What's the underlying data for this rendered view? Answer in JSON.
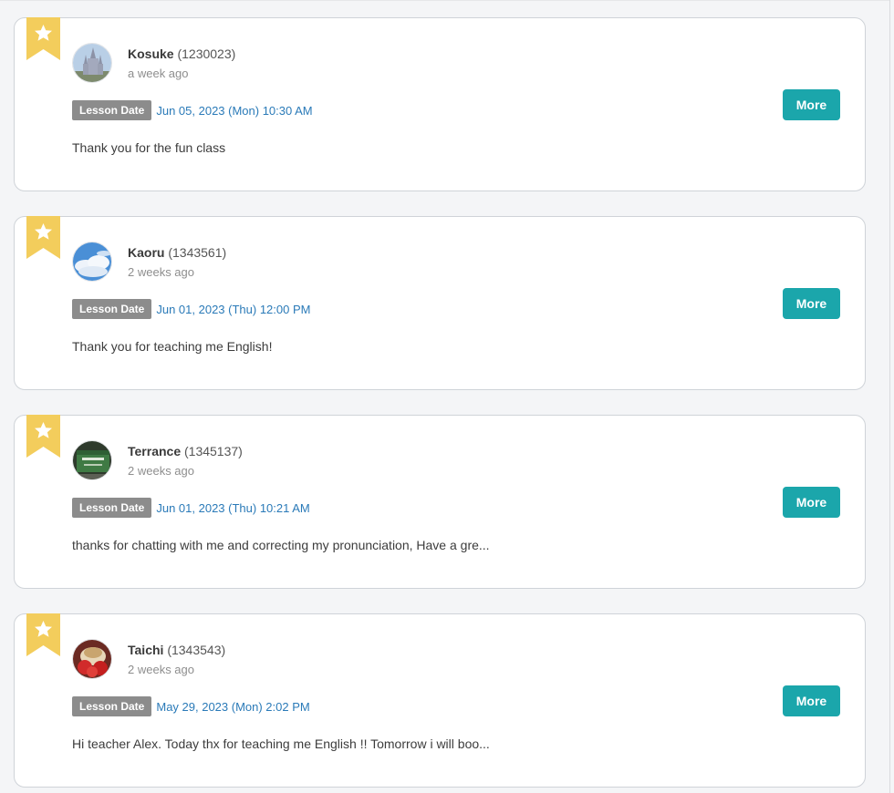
{
  "colors": {
    "ribbon": "#f3cd5c",
    "badge": "#8c8c8c",
    "date": "#2a7ab8",
    "more_button": "#1ba6ab"
  },
  "reviews": [
    {
      "student_name": "Kosuke",
      "student_id": "(1230023)",
      "time_ago": "a week ago",
      "lesson_label": "Lesson Date",
      "lesson_date": "Jun 05, 2023 (Mon) 10:30 AM",
      "comment": "Thank you for the fun class",
      "more_label": "More",
      "avatar_icon": "castle-photo-avatar"
    },
    {
      "student_name": "Kaoru",
      "student_id": "(1343561)",
      "time_ago": "2 weeks ago",
      "lesson_label": "Lesson Date",
      "lesson_date": "Jun 01, 2023 (Thu) 12:00 PM",
      "comment": "Thank you for teaching me English!",
      "more_label": "More",
      "avatar_icon": "sky-clouds-avatar"
    },
    {
      "student_name": "Terrance",
      "student_id": "(1345137)",
      "time_ago": "2 weeks ago",
      "lesson_label": "Lesson Date",
      "lesson_date": "Jun 01, 2023 (Thu) 10:21 AM",
      "comment": "thanks for chatting with me and correcting my pronunciation, Have a gre...",
      "more_label": "More",
      "avatar_icon": "green-sign-avatar"
    },
    {
      "student_name": "Taichi",
      "student_id": "(1343543)",
      "time_ago": "2 weeks ago",
      "lesson_label": "Lesson Date",
      "lesson_date": "May 29, 2023 (Mon) 2:02 PM",
      "comment": "Hi teacher Alex. Today thx for teaching me English !! Tomorrow i will boo...",
      "more_label": "More",
      "avatar_icon": "dessert-photo-avatar"
    }
  ]
}
